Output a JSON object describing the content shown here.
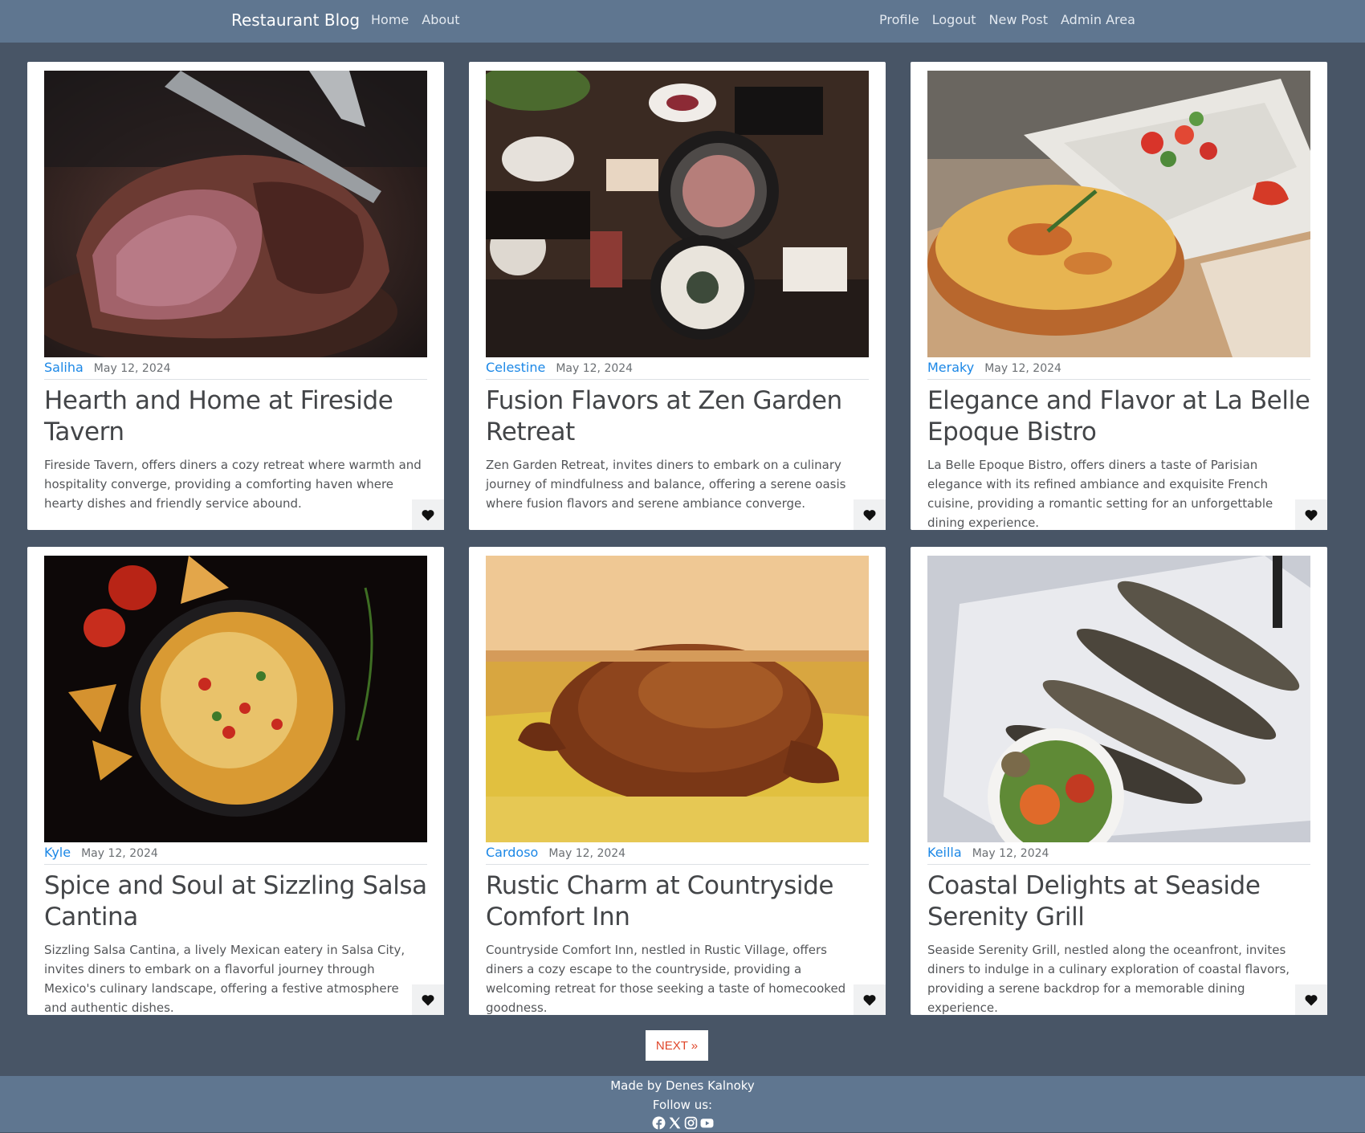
{
  "nav": {
    "brand": "Restaurant Blog",
    "left_links": [
      "Home",
      "About"
    ],
    "right_links": [
      "Profile",
      "Logout",
      "New Post",
      "Admin Area"
    ]
  },
  "posts": [
    {
      "author": "Saliha",
      "date": "May 12, 2024",
      "title": "Hearth and Home at Fireside Tavern",
      "excerpt": "Fireside Tavern, offers diners a cozy retreat where warmth and hospitality converge, providing a comforting haven where hearty dishes and friendly service abound.",
      "image": "steak-photo"
    },
    {
      "author": "Celestine",
      "date": "May 12, 2024",
      "title": "Fusion Flavors at Zen Garden Retreat",
      "excerpt": "Zen Garden Retreat, invites diners to embark on a culinary journey of mindfulness and balance, offering a serene oasis where fusion flavors and serene ambiance converge.",
      "image": "korean-bbq-table-photo"
    },
    {
      "author": "Meraky",
      "date": "May 12, 2024",
      "title": "Elegance and Flavor at La Belle Epoque Bistro",
      "excerpt": "La Belle Epoque Bistro, offers diners a taste of Parisian elegance with its refined ambiance and exquisite French cuisine, providing a romantic setting for an unforgettable dining experience.",
      "image": "quiche-photo"
    },
    {
      "author": "Kyle",
      "date": "May 12, 2024",
      "title": "Spice and Soul at Sizzling Salsa Cantina",
      "excerpt": "Sizzling Salsa Cantina, a lively Mexican eatery in Salsa City, invites diners to embark on a flavorful journey through Mexico's culinary landscape, offering a festive atmosphere and authentic dishes.",
      "image": "nachos-photo"
    },
    {
      "author": "Cardoso",
      "date": "May 12, 2024",
      "title": "Rustic Charm at Countryside Comfort Inn",
      "excerpt": "Countryside Comfort Inn, nestled in Rustic Village, offers diners a cozy escape to the countryside, providing a welcoming retreat for those seeking a taste of homecooked goodness.",
      "image": "roast-duck-photo"
    },
    {
      "author": "Keilla",
      "date": "May 12, 2024",
      "title": "Coastal Delights at Seaside Serenity Grill",
      "excerpt": "Seaside Serenity Grill, nestled along the oceanfront, invites diners to indulge in a culinary exploration of coastal flavors, providing a serene backdrop for a memorable dining experience.",
      "image": "grilled-sardines-photo"
    }
  ],
  "pagination": {
    "next_label": "NEXT »"
  },
  "footer": {
    "credit": "Made by Denes Kalnoky",
    "follow": "Follow us:",
    "social_icons": [
      "facebook-icon",
      "x-icon",
      "instagram-icon",
      "youtube-icon"
    ]
  },
  "colors": {
    "navbar": "#5f7690",
    "page_bg": "#485566",
    "author_link": "#1b87e6",
    "next_text": "#e0472b"
  }
}
